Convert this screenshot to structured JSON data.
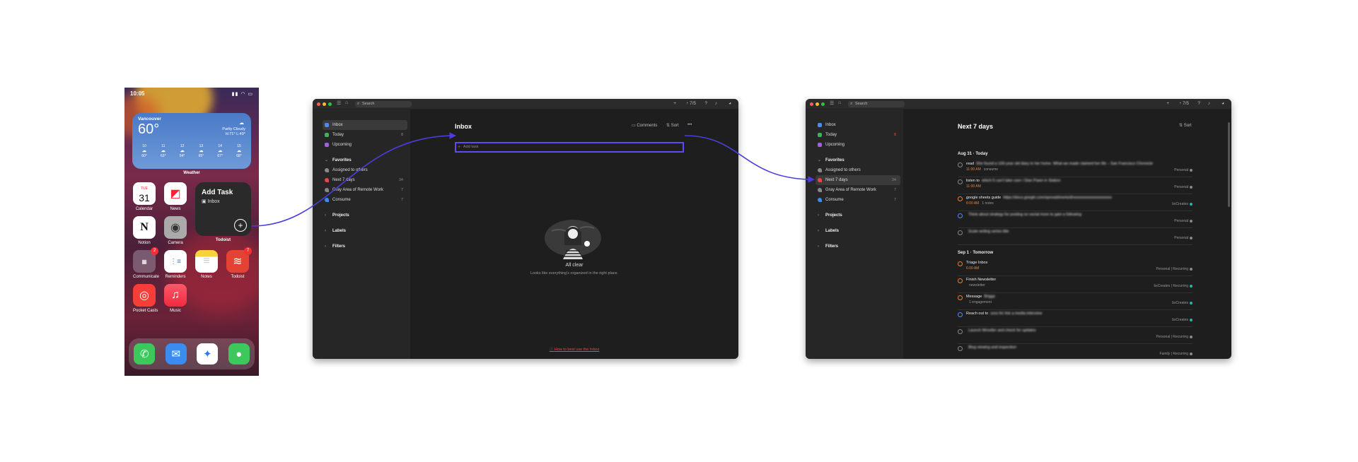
{
  "phone": {
    "time": "10:05",
    "weather": {
      "city": "Vancouver",
      "temp": "60°",
      "condition": "Partly Cloudy",
      "hilo": "H:71° L:49°",
      "hours": [
        {
          "h": "10",
          "t": "60°"
        },
        {
          "h": "11",
          "t": "63°"
        },
        {
          "h": "12",
          "t": "64°"
        },
        {
          "h": "13",
          "t": "65°"
        },
        {
          "h": "14",
          "t": "67°"
        },
        {
          "h": "15",
          "t": "68°"
        }
      ],
      "label": "Weather"
    },
    "apps": {
      "calendar": {
        "label": "Calendar",
        "day": "TUE",
        "date": "31"
      },
      "news": {
        "label": "News"
      },
      "notion": {
        "label": "Notion"
      },
      "camera": {
        "label": "Camera"
      },
      "communicate": {
        "label": "Communicate",
        "badge": "2"
      },
      "reminders": {
        "label": "Reminders"
      },
      "notes": {
        "label": "Notes"
      },
      "todoist": {
        "label": "Todoist",
        "badge": "7"
      },
      "pocketcasts": {
        "label": "Pocket Casts"
      },
      "music": {
        "label": "Music"
      }
    },
    "widget": {
      "title": "Add Task",
      "project": "Inbox",
      "label": "Todoist"
    }
  },
  "topbar": {
    "search": "Search",
    "karma": "7/5"
  },
  "sidebar": {
    "inbox": "Inbox",
    "today": "Today",
    "today_count": "8",
    "upcoming": "Upcoming",
    "favorites": "Favorites",
    "fav_items": [
      {
        "label": "Assigned to others",
        "count": ""
      },
      {
        "label": "Next 7 days",
        "count": "34"
      },
      {
        "label": "Gray Area of Remote Work",
        "count": "7"
      },
      {
        "label": "Consume",
        "count": "7"
      }
    ],
    "projects": "Projects",
    "labels": "Labels",
    "filters": "Filters"
  },
  "inbox_view": {
    "title": "Inbox",
    "comments": "Comments",
    "sort": "Sort",
    "add_task_placeholder": "Add task",
    "empty_title": "All clear",
    "empty_sub": "Looks like everything's organized in the right place.",
    "howto": "How to best use the Inbox"
  },
  "next7_view": {
    "title": "Next 7 days",
    "sort": "Sort",
    "sections": [
      {
        "heading": "Aug 31 · Today",
        "tasks": [
          {
            "title": "read",
            "blur": "She found a 100-year old diary in her home. What we made claimed her life – San Francisco Chronicle",
            "date": "11:00 AM",
            "extra": "consume",
            "project": "Personal",
            "color": "#888888",
            "prio": "#888888"
          },
          {
            "title": "listen to",
            "blur": "which 5 can't take care / Dian Pawn in Station",
            "date": "11:00 AM",
            "extra": "",
            "project": "Personal",
            "color": "#888888",
            "prio": "#888888"
          },
          {
            "title": "google sheets guide",
            "blur": "https://docs.google.com/spreadsheets/d/xxxxxxxxxxxxxxxxxxxx",
            "date": "8:00 AM",
            "extra": "1 notes",
            "project": "bxCreates",
            "color": "#2cb3a8",
            "prio": "#e8833a"
          },
          {
            "title": "",
            "blur": "Think about strategy for posting on social more to gain a following",
            "date": "",
            "extra": "",
            "project": "Personal",
            "color": "#888888",
            "prio": "#5a8cf0"
          },
          {
            "title": "",
            "blur": "Scale writing series title",
            "date": "",
            "extra": "",
            "project": "Personal",
            "color": "#888888",
            "prio": "#888888"
          }
        ]
      },
      {
        "heading": "Sep 1 · Tomorrow",
        "tasks": [
          {
            "title": "Triage Inbox",
            "blur": "",
            "date": "6:00 AM",
            "extra": "",
            "project": "Personal | Recurring",
            "color": "#888888",
            "prio": "#e8833a"
          },
          {
            "title": "Finish Newsletter",
            "blur": "",
            "date": "",
            "extra": "newsletter",
            "project": "bxCreates | Recurring",
            "color": "#2cb3a8",
            "prio": "#e8833a"
          },
          {
            "title": "Message",
            "blur": "Briggs",
            "date": "",
            "extra": "1 engagement",
            "project": "bxCreates",
            "color": "#2cb3a8",
            "prio": "#e8833a"
          },
          {
            "title": "Reach out to",
            "blur": "xxxx for link a media interview",
            "date": "",
            "extra": "",
            "project": "bxCreates",
            "color": "#2cb3a8",
            "prio": "#5a8cf0"
          },
          {
            "title": "",
            "blur": "Launch Wrestler and check for updates",
            "date": "",
            "extra": "",
            "project": "Personal | Recurring",
            "color": "#888888",
            "prio": "#888888"
          },
          {
            "title": "",
            "blur": "Blog viewing and inspection",
            "date": "",
            "extra": "",
            "project": "Family | Recurring",
            "color": "#888888",
            "prio": "#888888"
          }
        ]
      }
    ]
  },
  "colors": {
    "accent": "#5b4ef0",
    "red": "#e44232",
    "window_bg": "#1e1e1e",
    "sidebar_bg": "#262626"
  }
}
